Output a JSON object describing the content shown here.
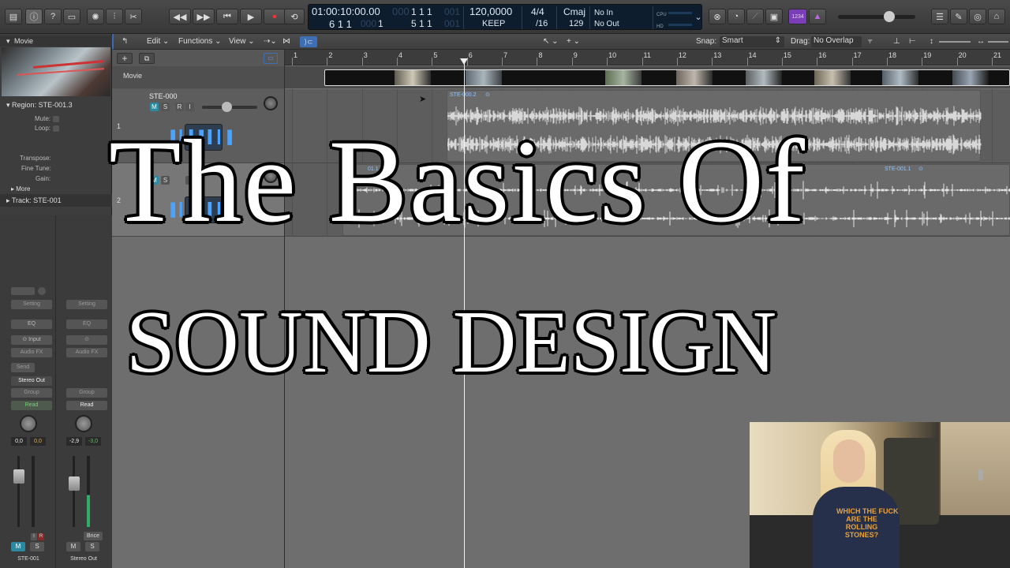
{
  "lcd": {
    "time": "01:00:10:00.00",
    "time_dim": "000",
    "bars_top": "1  1  1",
    "bars_top_dim": "001",
    "position": "6  1  1",
    "position_dim": "000",
    "position_tail": "1",
    "bars_bottom": "5  1  1",
    "bars_bottom_dim": "001",
    "tempo": "120,0000",
    "tempo_mode": "KEEP",
    "signature": "4/4",
    "division": "/16",
    "key": "Cmaj",
    "key_value": "129",
    "midi_in": "No In",
    "midi_out": "No Out",
    "cpu_label": "CPU",
    "hd_label": "HD"
  },
  "topbar": {
    "mode_badge": "1234"
  },
  "menubar": {
    "edit": "Edit",
    "functions": "Functions",
    "view": "View",
    "snap_label": "Snap:",
    "snap_value": "Smart",
    "drag_label": "Drag:",
    "drag_value": "No Overlap"
  },
  "inspector": {
    "region_label": "Region:",
    "region_name": "STE-001.3",
    "mute": "Mute:",
    "loop": "Loop:",
    "transpose": "Transpose:",
    "fine_tune": "Fine Tune:",
    "gain": "Gain:",
    "more": "More",
    "track_label": "Track:",
    "track_name": "STE-001",
    "movie_label": "Movie"
  },
  "strips": [
    {
      "setting": "Setting",
      "eq": "EQ",
      "input": "Input",
      "audio_fx": "Audio FX",
      "send": "Send",
      "output": "Stereo Out",
      "group": "Group",
      "automation": "Read",
      "vol_left": "0,0",
      "vol_right": "0,0",
      "mute": "M",
      "solo": "S",
      "name": "STE-001",
      "record": "I",
      "rec2": "R",
      "bounce": ""
    },
    {
      "setting": "Setting",
      "eq": "EQ",
      "input": "",
      "audio_fx": "Audio FX",
      "send": "",
      "output": "",
      "group": "Group",
      "automation": "Read",
      "vol_left": "-2,9",
      "vol_right": "-3,0",
      "mute": "M",
      "solo": "S",
      "name": "Stereo Out",
      "record": "",
      "rec2": "",
      "bounce": "Bnce"
    }
  ],
  "tracks": [
    {
      "number": "1",
      "name": "STE-000",
      "m": "M",
      "s": "S",
      "r": "R",
      "i": "I"
    },
    {
      "number": "2",
      "name": "",
      "m": "M",
      "s": "S",
      "r": "",
      "i": "I"
    }
  ],
  "movie_track_label": "Movie",
  "regions": {
    "r1": "STE-000.2",
    "r2": "01.1",
    "r3": "STE-001.1"
  },
  "ruler": [
    "1",
    "2",
    "3",
    "4",
    "5",
    "6",
    "7",
    "8",
    "9",
    "10",
    "11",
    "12",
    "13",
    "14",
    "15",
    "16",
    "17",
    "18",
    "19",
    "20",
    "21"
  ],
  "overlay": {
    "line1": "The Basics Of",
    "line2": "SOUND DESIGN"
  },
  "shirt_text": "WHICH THE FUCK\nARE THE\nROLLING\nSTONES?"
}
